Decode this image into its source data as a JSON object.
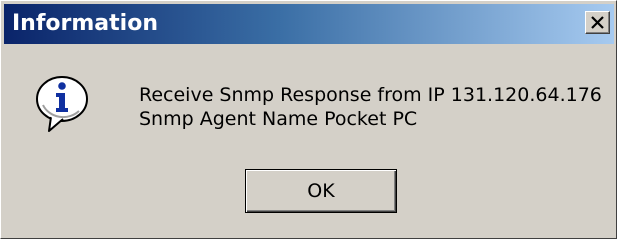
{
  "dialog": {
    "title": "Information",
    "close_glyph": "x",
    "icon": "information-icon",
    "message_lines": [
      "Receive Snmp Response from IP 131.120.64.176",
      "Snmp Agent Name Pocket PC"
    ],
    "ok_label": "OK"
  },
  "colors": {
    "titlebar_start": "#0a246a",
    "titlebar_end": "#a6caf0",
    "face": "#d4d0c8",
    "icon_blue": "#1030a0"
  }
}
